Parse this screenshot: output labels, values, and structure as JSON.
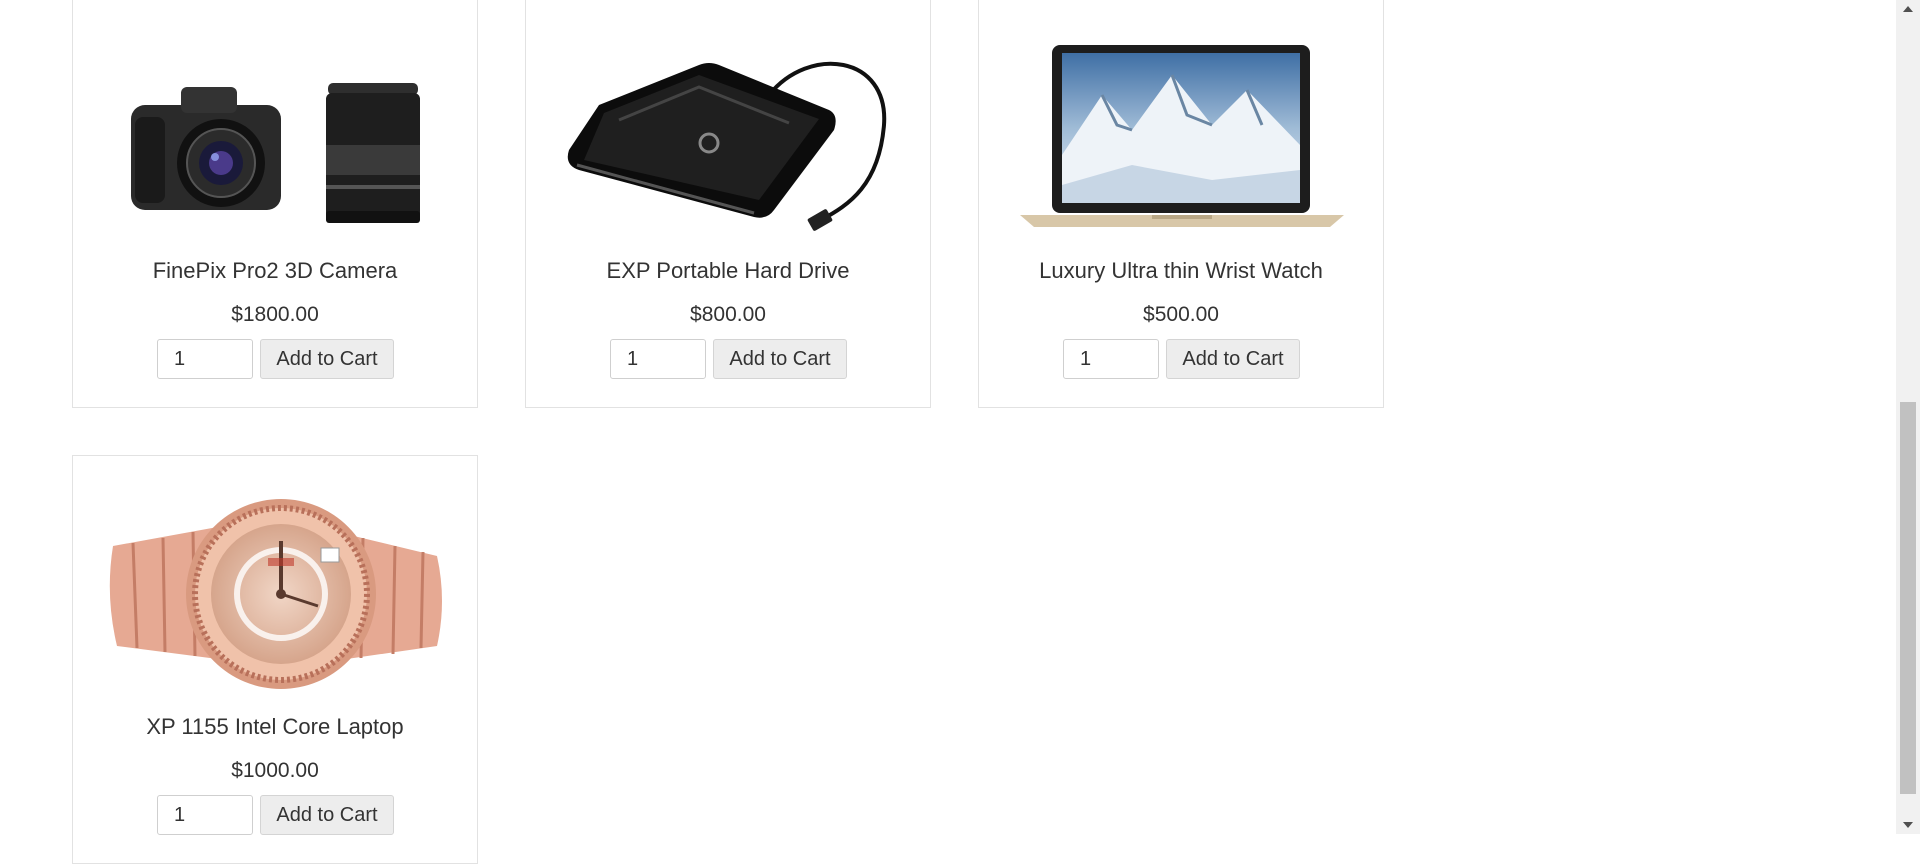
{
  "products": [
    {
      "title": "FinePix Pro2 3D Camera",
      "price": "$1800.00",
      "qty": "1",
      "button": "Add to Cart",
      "image": "camera-image"
    },
    {
      "title": "EXP Portable Hard Drive",
      "price": "$800.00",
      "qty": "1",
      "button": "Add to Cart",
      "image": "hard-drive-image"
    },
    {
      "title": "Luxury Ultra thin Wrist Watch",
      "price": "$500.00",
      "qty": "1",
      "button": "Add to Cart",
      "image": "laptop-image"
    },
    {
      "title": "XP 1155 Intel Core Laptop",
      "price": "$1000.00",
      "qty": "1",
      "button": "Add to Cart",
      "image": "watch-image"
    }
  ],
  "scrollbar": {
    "up_icon": "chevron-up-icon",
    "down_icon": "chevron-down-icon"
  }
}
